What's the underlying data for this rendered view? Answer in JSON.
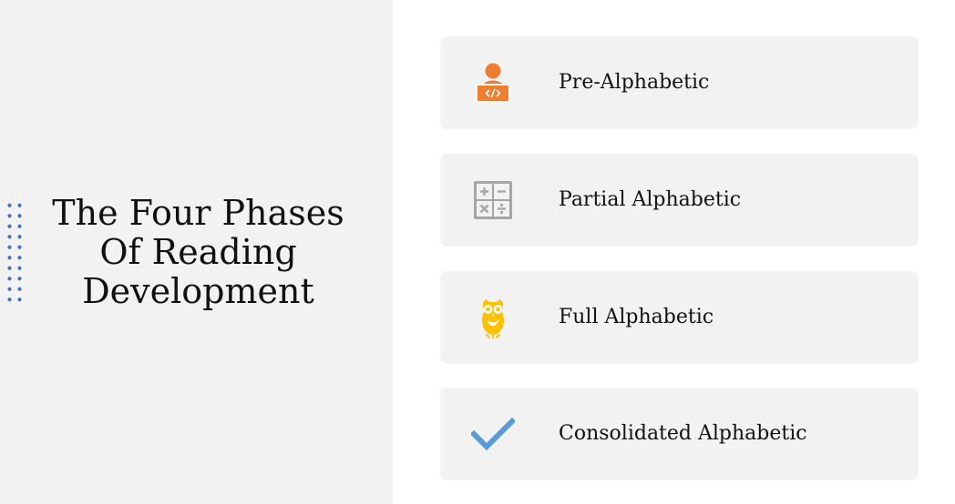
{
  "slide": {
    "title_lines": [
      "The Four Phases",
      "Of Reading",
      "Development"
    ]
  },
  "phases": [
    {
      "label": "Pre-Alphabetic",
      "icon": "developer-laptop-icon",
      "icon_color": "#ed7d31"
    },
    {
      "label": "Partial Alphabetic",
      "icon": "calculator-icon",
      "icon_color": "#a6a6a6"
    },
    {
      "label": "Full Alphabetic",
      "icon": "owl-icon",
      "icon_color": "#ffc000"
    },
    {
      "label": "Consolidated Alphabetic",
      "icon": "checkmark-icon",
      "icon_color": "#5b9bd5"
    }
  ],
  "colors": {
    "panel_background": "#f2f2f2",
    "dots_accent": "#4472c4",
    "text": "#111111"
  }
}
